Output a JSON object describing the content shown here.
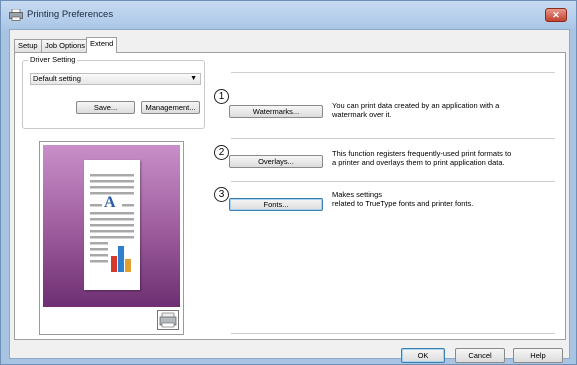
{
  "window": {
    "title": "Printing Preferences",
    "close_glyph": "✕"
  },
  "tabs": [
    {
      "label": "Setup"
    },
    {
      "label": "Job Options"
    },
    {
      "label": "Extend"
    }
  ],
  "driver_setting": {
    "legend": "Driver Setting",
    "selected": "Default setting",
    "save_label": "Save...",
    "management_label": "Management..."
  },
  "features": [
    {
      "number": "1",
      "button": "Watermarks...",
      "description": "You can print data created by an application with a\n watermark over it."
    },
    {
      "number": "2",
      "button": "Overlays...",
      "description": "This function registers frequently-used print formats to\n a printer and overlays them to print application data."
    },
    {
      "number": "3",
      "button": "Fonts...",
      "description": "Makes settings\n related to TrueType fonts and printer fonts."
    }
  ],
  "preview": {
    "page_letter": "A"
  },
  "buttons": {
    "ok": "OK",
    "cancel": "Cancel",
    "help": "Help"
  },
  "icons": {
    "title": "printer-icon",
    "preview": "printer-device-icon"
  },
  "colors": {
    "preview_bg": "#a464a4",
    "chart_bars": [
      "#d63a2a",
      "#2f7fd0",
      "#e0a030"
    ]
  }
}
